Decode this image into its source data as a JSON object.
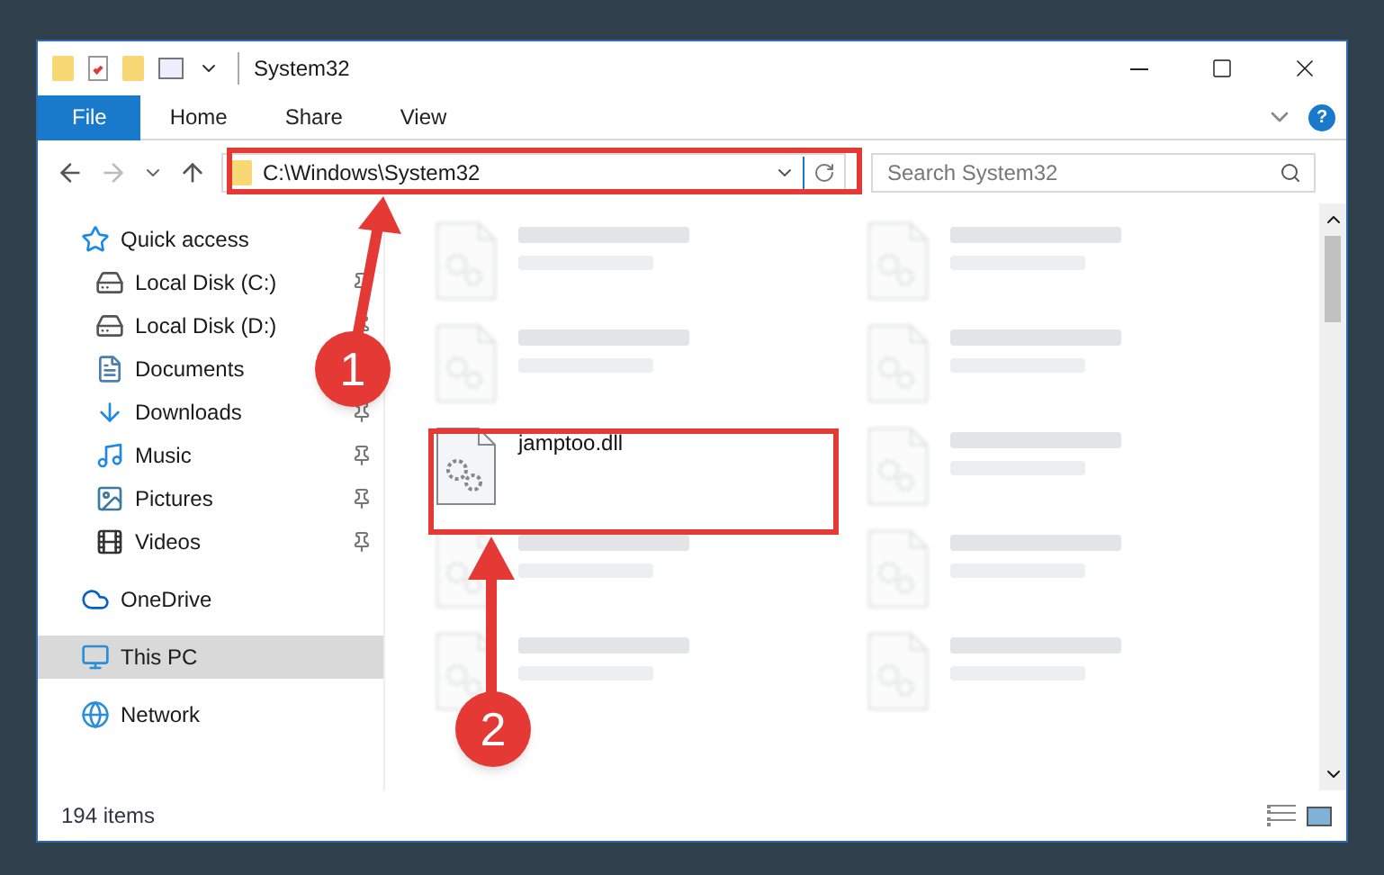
{
  "window": {
    "title": "System32",
    "help": "?"
  },
  "ribbon_tabs": [
    {
      "label": "File",
      "selected": true
    },
    {
      "label": "Home",
      "selected": false
    },
    {
      "label": "Share",
      "selected": false
    },
    {
      "label": "View",
      "selected": false
    }
  ],
  "address": {
    "path": "C:\\Windows\\System32"
  },
  "search": {
    "placeholder": "Search System32"
  },
  "sidebar": {
    "items": [
      {
        "label": "Quick access",
        "kind": "quick",
        "selected": false,
        "children": [
          {
            "label": "Local Disk (C:)",
            "kind": "drive-c",
            "pinned": true
          },
          {
            "label": "Local Disk (D:)",
            "kind": "drive",
            "pinned": true
          },
          {
            "label": "Documents",
            "kind": "documents",
            "pinned": false
          },
          {
            "label": "Downloads",
            "kind": "downloads",
            "pinned": true
          },
          {
            "label": "Music",
            "kind": "music",
            "pinned": true
          },
          {
            "label": "Pictures",
            "kind": "pictures",
            "pinned": true
          },
          {
            "label": "Videos",
            "kind": "videos",
            "pinned": true
          }
        ]
      },
      {
        "label": "OneDrive",
        "kind": "cloud",
        "selected": false
      },
      {
        "label": "This PC",
        "kind": "pc",
        "selected": true
      },
      {
        "label": "Network",
        "kind": "network",
        "selected": false
      }
    ]
  },
  "files": [
    {
      "blurred": true
    },
    {
      "blurred": true
    },
    {
      "blurred": true
    },
    {
      "blurred": true
    },
    {
      "name": "jamptoo.dll",
      "blurred": false
    },
    {
      "blurred": true
    },
    {
      "blurred": true
    },
    {
      "blurred": true
    },
    {
      "blurred": true
    },
    {
      "blurred": true
    }
  ],
  "status_bar": {
    "count": "194 items"
  },
  "annotations": [
    {
      "number": "1"
    },
    {
      "number": "2"
    }
  ]
}
